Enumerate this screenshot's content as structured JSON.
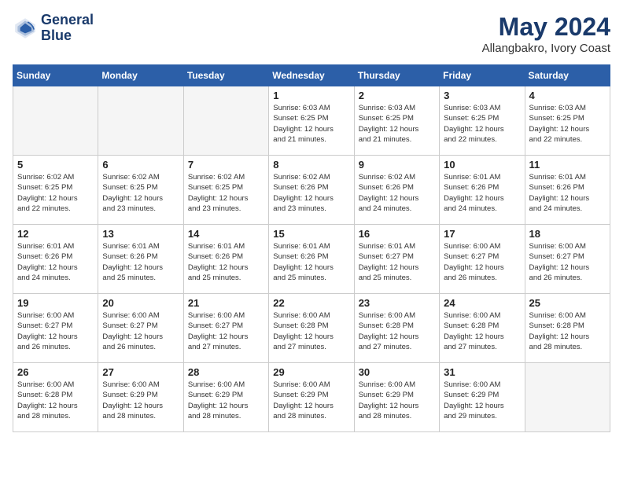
{
  "header": {
    "logo_line1": "General",
    "logo_line2": "Blue",
    "month_year": "May 2024",
    "location": "Allangbakro, Ivory Coast"
  },
  "weekdays": [
    "Sunday",
    "Monday",
    "Tuesday",
    "Wednesday",
    "Thursday",
    "Friday",
    "Saturday"
  ],
  "weeks": [
    [
      {
        "day": "",
        "info": ""
      },
      {
        "day": "",
        "info": ""
      },
      {
        "day": "",
        "info": ""
      },
      {
        "day": "1",
        "info": "Sunrise: 6:03 AM\nSunset: 6:25 PM\nDaylight: 12 hours\nand 21 minutes."
      },
      {
        "day": "2",
        "info": "Sunrise: 6:03 AM\nSunset: 6:25 PM\nDaylight: 12 hours\nand 21 minutes."
      },
      {
        "day": "3",
        "info": "Sunrise: 6:03 AM\nSunset: 6:25 PM\nDaylight: 12 hours\nand 22 minutes."
      },
      {
        "day": "4",
        "info": "Sunrise: 6:03 AM\nSunset: 6:25 PM\nDaylight: 12 hours\nand 22 minutes."
      }
    ],
    [
      {
        "day": "5",
        "info": "Sunrise: 6:02 AM\nSunset: 6:25 PM\nDaylight: 12 hours\nand 22 minutes."
      },
      {
        "day": "6",
        "info": "Sunrise: 6:02 AM\nSunset: 6:25 PM\nDaylight: 12 hours\nand 23 minutes."
      },
      {
        "day": "7",
        "info": "Sunrise: 6:02 AM\nSunset: 6:25 PM\nDaylight: 12 hours\nand 23 minutes."
      },
      {
        "day": "8",
        "info": "Sunrise: 6:02 AM\nSunset: 6:26 PM\nDaylight: 12 hours\nand 23 minutes."
      },
      {
        "day": "9",
        "info": "Sunrise: 6:02 AM\nSunset: 6:26 PM\nDaylight: 12 hours\nand 24 minutes."
      },
      {
        "day": "10",
        "info": "Sunrise: 6:01 AM\nSunset: 6:26 PM\nDaylight: 12 hours\nand 24 minutes."
      },
      {
        "day": "11",
        "info": "Sunrise: 6:01 AM\nSunset: 6:26 PM\nDaylight: 12 hours\nand 24 minutes."
      }
    ],
    [
      {
        "day": "12",
        "info": "Sunrise: 6:01 AM\nSunset: 6:26 PM\nDaylight: 12 hours\nand 24 minutes."
      },
      {
        "day": "13",
        "info": "Sunrise: 6:01 AM\nSunset: 6:26 PM\nDaylight: 12 hours\nand 25 minutes."
      },
      {
        "day": "14",
        "info": "Sunrise: 6:01 AM\nSunset: 6:26 PM\nDaylight: 12 hours\nand 25 minutes."
      },
      {
        "day": "15",
        "info": "Sunrise: 6:01 AM\nSunset: 6:26 PM\nDaylight: 12 hours\nand 25 minutes."
      },
      {
        "day": "16",
        "info": "Sunrise: 6:01 AM\nSunset: 6:27 PM\nDaylight: 12 hours\nand 25 minutes."
      },
      {
        "day": "17",
        "info": "Sunrise: 6:00 AM\nSunset: 6:27 PM\nDaylight: 12 hours\nand 26 minutes."
      },
      {
        "day": "18",
        "info": "Sunrise: 6:00 AM\nSunset: 6:27 PM\nDaylight: 12 hours\nand 26 minutes."
      }
    ],
    [
      {
        "day": "19",
        "info": "Sunrise: 6:00 AM\nSunset: 6:27 PM\nDaylight: 12 hours\nand 26 minutes."
      },
      {
        "day": "20",
        "info": "Sunrise: 6:00 AM\nSunset: 6:27 PM\nDaylight: 12 hours\nand 26 minutes."
      },
      {
        "day": "21",
        "info": "Sunrise: 6:00 AM\nSunset: 6:27 PM\nDaylight: 12 hours\nand 27 minutes."
      },
      {
        "day": "22",
        "info": "Sunrise: 6:00 AM\nSunset: 6:28 PM\nDaylight: 12 hours\nand 27 minutes."
      },
      {
        "day": "23",
        "info": "Sunrise: 6:00 AM\nSunset: 6:28 PM\nDaylight: 12 hours\nand 27 minutes."
      },
      {
        "day": "24",
        "info": "Sunrise: 6:00 AM\nSunset: 6:28 PM\nDaylight: 12 hours\nand 27 minutes."
      },
      {
        "day": "25",
        "info": "Sunrise: 6:00 AM\nSunset: 6:28 PM\nDaylight: 12 hours\nand 28 minutes."
      }
    ],
    [
      {
        "day": "26",
        "info": "Sunrise: 6:00 AM\nSunset: 6:28 PM\nDaylight: 12 hours\nand 28 minutes."
      },
      {
        "day": "27",
        "info": "Sunrise: 6:00 AM\nSunset: 6:29 PM\nDaylight: 12 hours\nand 28 minutes."
      },
      {
        "day": "28",
        "info": "Sunrise: 6:00 AM\nSunset: 6:29 PM\nDaylight: 12 hours\nand 28 minutes."
      },
      {
        "day": "29",
        "info": "Sunrise: 6:00 AM\nSunset: 6:29 PM\nDaylight: 12 hours\nand 28 minutes."
      },
      {
        "day": "30",
        "info": "Sunrise: 6:00 AM\nSunset: 6:29 PM\nDaylight: 12 hours\nand 28 minutes."
      },
      {
        "day": "31",
        "info": "Sunrise: 6:00 AM\nSunset: 6:29 PM\nDaylight: 12 hours\nand 29 minutes."
      },
      {
        "day": "",
        "info": ""
      }
    ]
  ]
}
